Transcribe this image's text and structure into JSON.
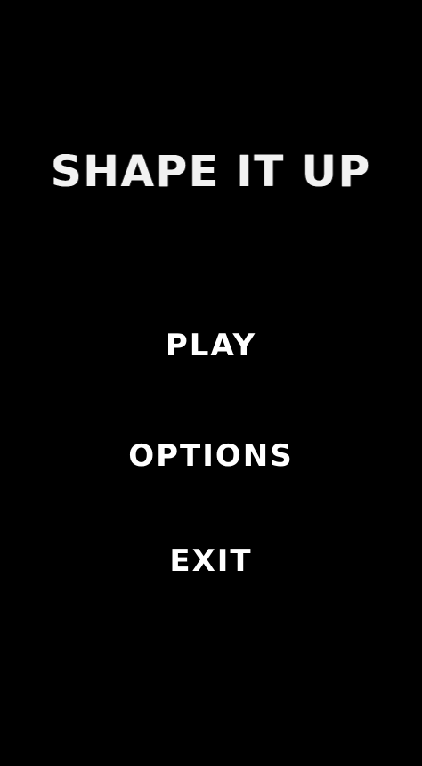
{
  "title": "SHAPE IT UP",
  "menu": {
    "play_label": "PLAY",
    "options_label": "OPTIONS",
    "exit_label": "EXIT"
  },
  "colors": {
    "background": "#000000",
    "text": "#ffffff"
  }
}
